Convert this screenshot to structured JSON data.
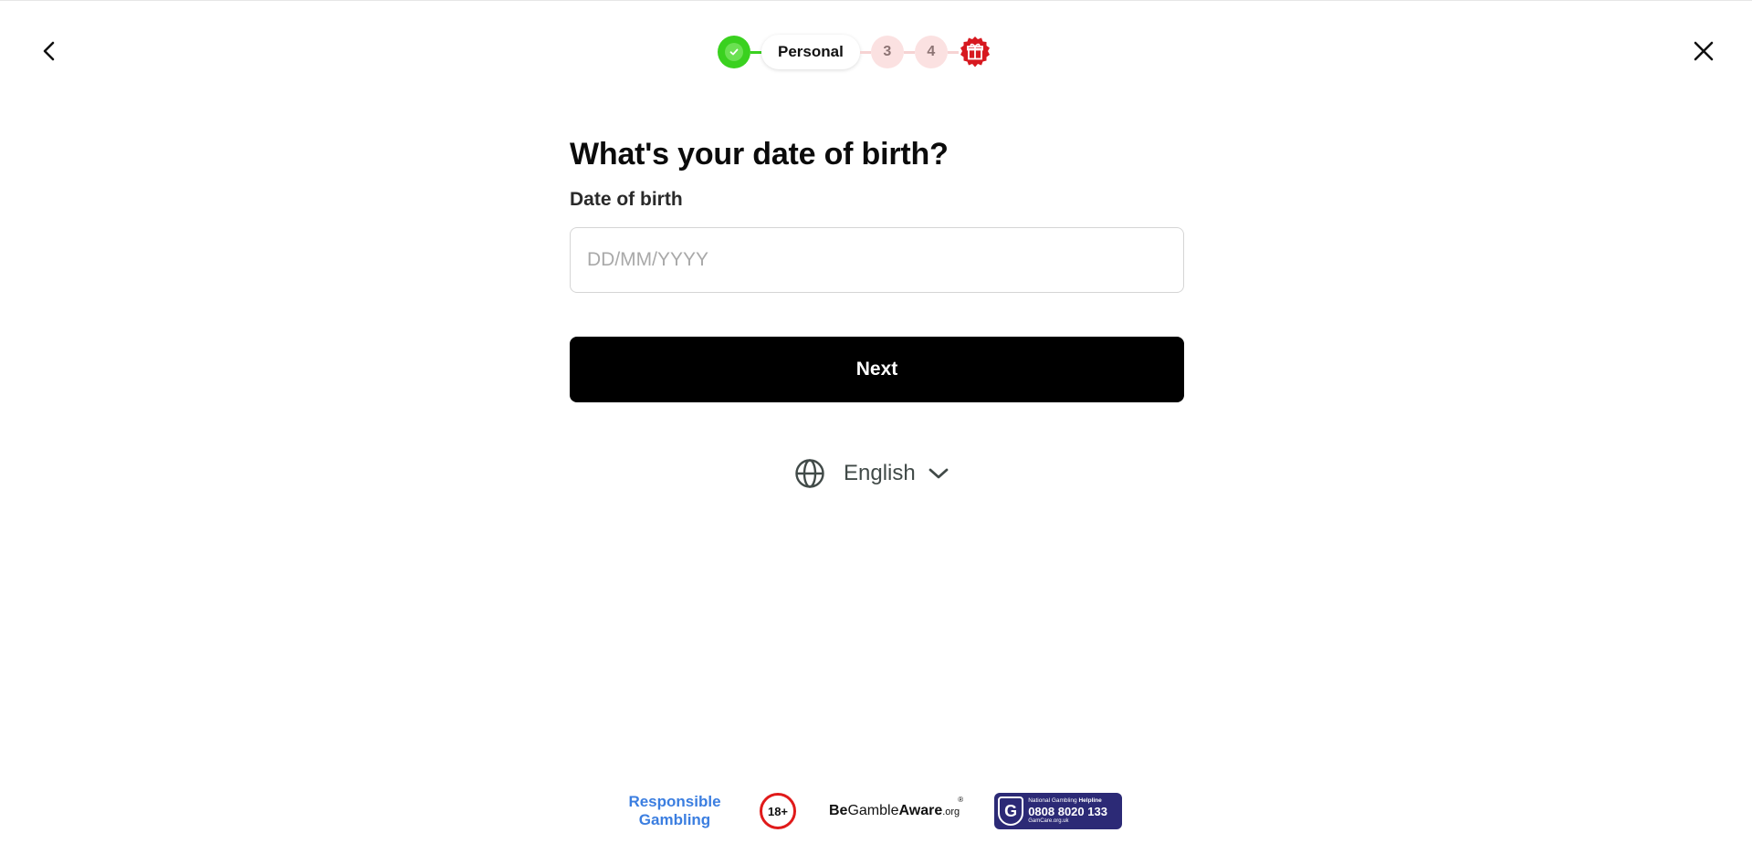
{
  "header": {
    "back_icon": "chevron-left-icon",
    "close_icon": "close-icon",
    "steps": [
      {
        "state": "done",
        "icon": "check-icon"
      },
      {
        "state": "current",
        "label": "Personal"
      },
      {
        "state": "pending",
        "label": "3"
      },
      {
        "state": "pending",
        "label": "4"
      },
      {
        "state": "reward",
        "icon": "gift-icon"
      }
    ]
  },
  "form": {
    "title": "What's your date of birth?",
    "dob_label": "Date of birth",
    "dob_placeholder": "DD/MM/YYYY",
    "dob_value": "",
    "next_label": "Next"
  },
  "language": {
    "icon": "globe-icon",
    "selected": "English",
    "dropdown_icon": "chevron-down-icon"
  },
  "footer": {
    "responsible_line1": "Responsible",
    "responsible_line2": "Gambling",
    "age_badge": "18+",
    "begambleaware_be": "Be",
    "begambleaware_gamble": "Gamble",
    "begambleaware_aware": "Aware",
    "begambleaware_org": ".org",
    "begambleaware_reg": "®",
    "helpline_letter": "G",
    "helpline_title_light": "National Gambling",
    "helpline_title_bold": "Helpline",
    "helpline_number": "0808 8020 133",
    "helpline_site": "GamCare.org.uk"
  },
  "colors": {
    "accent_done": "#3ad11f",
    "pending_step": "#fbe1e1",
    "gift_badge": "#d71920",
    "primary_button": "#000000",
    "responsible_text": "#3b7ee0",
    "helpline_bg": "#2c2a76"
  }
}
